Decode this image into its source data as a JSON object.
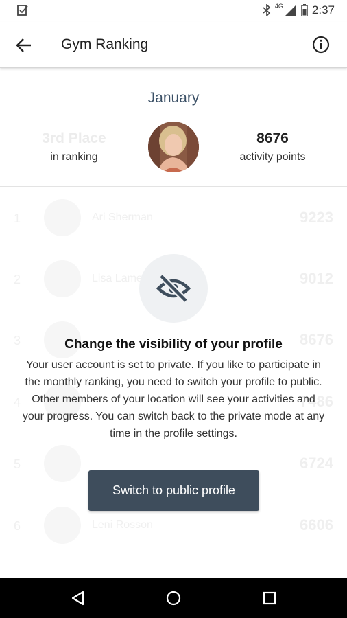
{
  "status_bar": {
    "time": "2:37",
    "network": "4G",
    "icons": [
      "checklist-icon",
      "bluetooth-icon",
      "signal-icon",
      "battery-icon"
    ]
  },
  "app_bar": {
    "title": "Gym Ranking",
    "back_icon": "back-arrow-icon",
    "info_icon": "info-icon"
  },
  "summary": {
    "month": "January",
    "rank_value": "3rd Place",
    "rank_label": "in ranking",
    "points_value": "8676",
    "points_label": "activity points"
  },
  "ranking_list": [
    {
      "position": "1",
      "name": "Ari Sherman",
      "points": "9223"
    },
    {
      "position": "2",
      "name": "Lisa Lamen",
      "points": "9012"
    },
    {
      "position": "3",
      "name": "",
      "points": "8676"
    },
    {
      "position": "4",
      "name": "",
      "points": "7486"
    },
    {
      "position": "5",
      "name": "",
      "points": "6724"
    },
    {
      "position": "6",
      "name": "Leni Rosson",
      "points": "6606"
    }
  ],
  "private_overlay": {
    "icon": "visibility-off-icon",
    "title": "Change the visibility of your profile",
    "body": "Your user account is set to private. If you like to participate in the monthly ranking, you need to switch your profile to public. Other members of your location will see your activities and your progress. You can switch back to the private mode at any time in the profile settings.",
    "button_label": "Switch to public profile"
  },
  "colors": {
    "accent": "#3e4d5c",
    "month_text": "#3b5066",
    "icon_circle": "#eff1f3"
  }
}
